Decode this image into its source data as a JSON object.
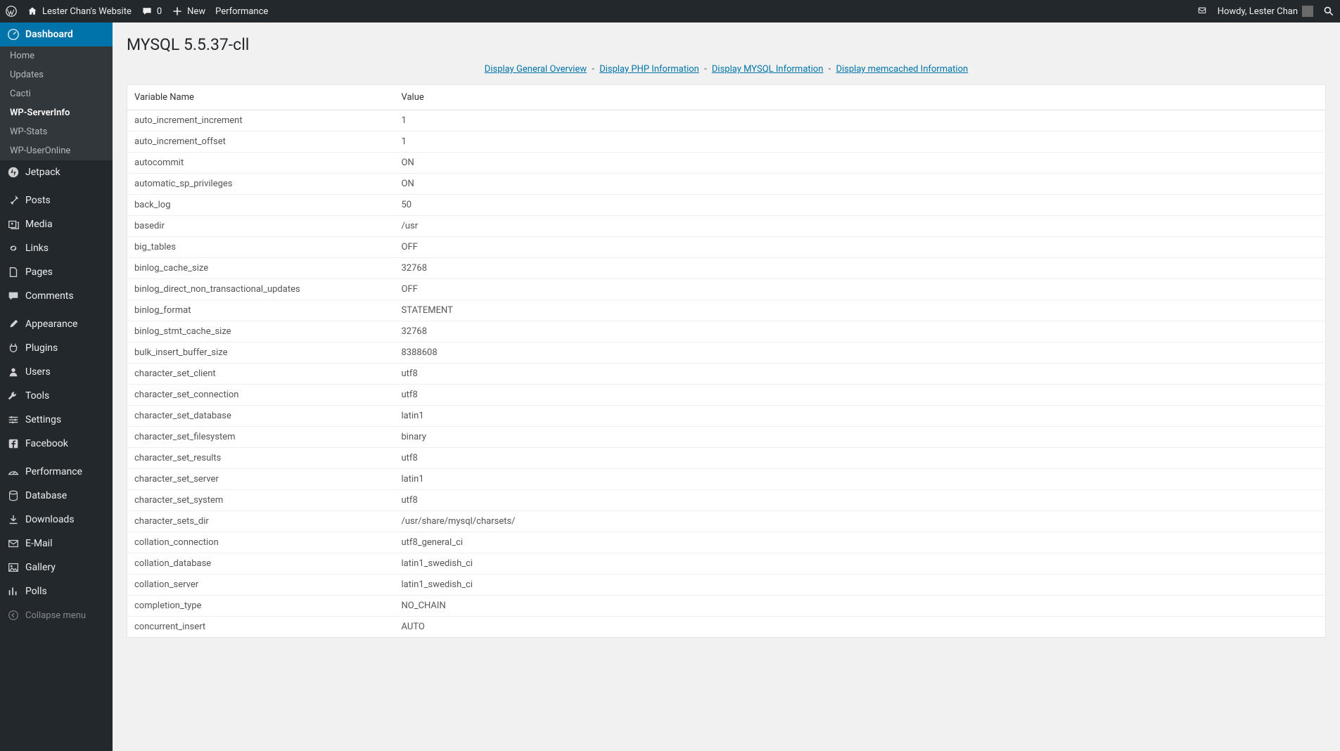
{
  "adminbar": {
    "site_name": "Lester Chan's Website",
    "comments_count": "0",
    "new_label": "New",
    "performance_label": "Performance",
    "howdy": "Howdy, Lester Chan"
  },
  "sidebar": {
    "dashboard": "Dashboard",
    "submenu": [
      {
        "label": "Home",
        "active": false
      },
      {
        "label": "Updates",
        "active": false
      },
      {
        "label": "Cacti",
        "active": false
      },
      {
        "label": "WP-ServerInfo",
        "active": true
      },
      {
        "label": "WP-Stats",
        "active": false
      },
      {
        "label": "WP-UserOnline",
        "active": false
      }
    ],
    "jetpack": "Jetpack",
    "posts": "Posts",
    "media": "Media",
    "links": "Links",
    "pages": "Pages",
    "comments": "Comments",
    "appearance": "Appearance",
    "plugins": "Plugins",
    "users": "Users",
    "tools": "Tools",
    "settings": "Settings",
    "facebook": "Facebook",
    "performance": "Performance",
    "database": "Database",
    "downloads": "Downloads",
    "email": "E-Mail",
    "gallery": "Gallery",
    "polls": "Polls",
    "collapse": "Collapse menu"
  },
  "page": {
    "title": "MYSQL 5.5.37-cll",
    "links": [
      "Display General Overview",
      "Display PHP Information",
      "Display MYSQL Information",
      "Display memcached Information"
    ],
    "link_sep": " - "
  },
  "table": {
    "col1": "Variable Name",
    "col2": "Value",
    "rows": [
      {
        "name": "auto_increment_increment",
        "value": "1"
      },
      {
        "name": "auto_increment_offset",
        "value": "1"
      },
      {
        "name": "autocommit",
        "value": "ON"
      },
      {
        "name": "automatic_sp_privileges",
        "value": "ON"
      },
      {
        "name": "back_log",
        "value": "50"
      },
      {
        "name": "basedir",
        "value": "/usr"
      },
      {
        "name": "big_tables",
        "value": "OFF"
      },
      {
        "name": "binlog_cache_size",
        "value": "32768"
      },
      {
        "name": "binlog_direct_non_transactional_updates",
        "value": "OFF"
      },
      {
        "name": "binlog_format",
        "value": "STATEMENT"
      },
      {
        "name": "binlog_stmt_cache_size",
        "value": "32768"
      },
      {
        "name": "bulk_insert_buffer_size",
        "value": "8388608"
      },
      {
        "name": "character_set_client",
        "value": "utf8"
      },
      {
        "name": "character_set_connection",
        "value": "utf8"
      },
      {
        "name": "character_set_database",
        "value": "latin1"
      },
      {
        "name": "character_set_filesystem",
        "value": "binary"
      },
      {
        "name": "character_set_results",
        "value": "utf8"
      },
      {
        "name": "character_set_server",
        "value": "latin1"
      },
      {
        "name": "character_set_system",
        "value": "utf8"
      },
      {
        "name": "character_sets_dir",
        "value": "/usr/share/mysql/charsets/"
      },
      {
        "name": "collation_connection",
        "value": "utf8_general_ci"
      },
      {
        "name": "collation_database",
        "value": "latin1_swedish_ci"
      },
      {
        "name": "collation_server",
        "value": "latin1_swedish_ci"
      },
      {
        "name": "completion_type",
        "value": "NO_CHAIN"
      },
      {
        "name": "concurrent_insert",
        "value": "AUTO"
      }
    ]
  }
}
